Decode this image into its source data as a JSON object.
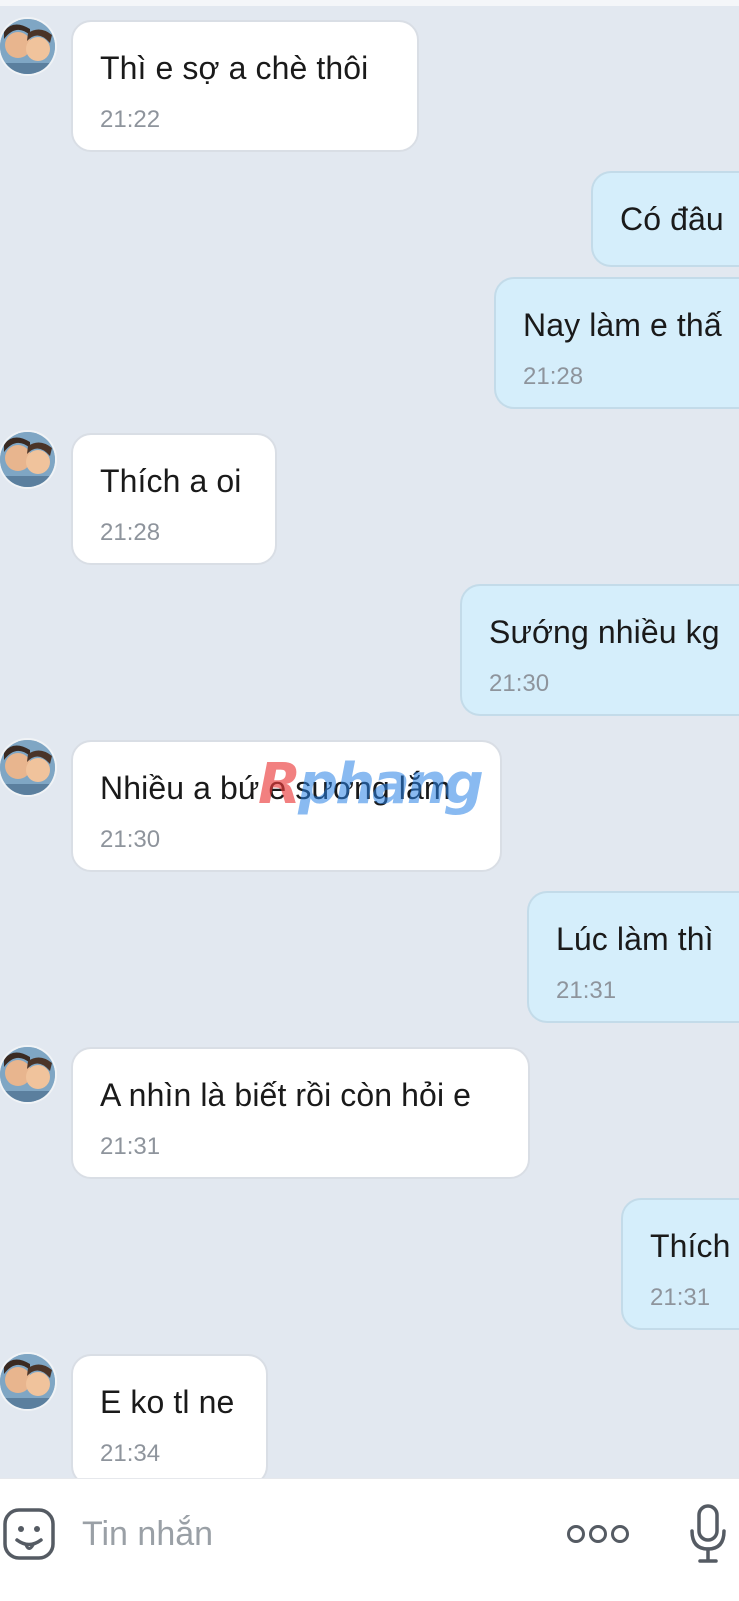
{
  "messages": [
    {
      "text": "Thì e sợ a chè thôi",
      "time": "21:22"
    },
    {
      "text": "Có đâu"
    },
    {
      "text": "Nay làm e thấ",
      "time": "21:28"
    },
    {
      "text": "Thích a oi",
      "time": "21:28"
    },
    {
      "text": "Sướng nhiều kg",
      "time": "21:30"
    },
    {
      "text": "Nhiều a bứ e sương lắm",
      "time": "21:30"
    },
    {
      "text": "Lúc làm thì",
      "time": "21:31"
    },
    {
      "text": "A nhìn là biết rồi còn hỏi e",
      "time": "21:31"
    },
    {
      "text": "Thích",
      "time": "21:31"
    },
    {
      "text": "E ko tl ne",
      "time": "21:34"
    }
  ],
  "watermark": {
    "prefix": "R",
    "rest": "phang"
  },
  "composer": {
    "placeholder": "Tin nhắn"
  }
}
